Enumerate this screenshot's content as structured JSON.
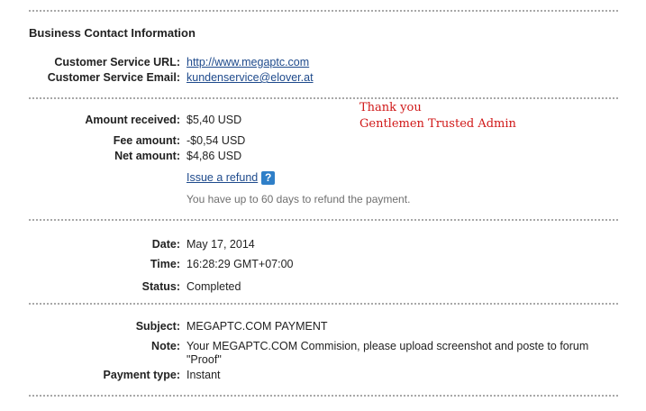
{
  "business": {
    "title": "Business Contact Information",
    "service_url_label": "Customer Service URL:",
    "service_url": "http://www.megaptc.com",
    "service_email_label": "Customer Service Email:",
    "service_email": "kundenservice@elover.at"
  },
  "amounts": {
    "received_label": "Amount received:",
    "received": "$5,40 USD",
    "fee_label": "Fee amount:",
    "fee": "-$0,54 USD",
    "net_label": "Net amount:",
    "net": "$4,86 USD",
    "refund_link": "Issue a refund",
    "help_icon_text": "?",
    "refund_hint": "You have up to 60 days to refund the payment."
  },
  "annotation": {
    "line1": "Thank you",
    "line2": "Gentlemen Trusted Admin"
  },
  "details": {
    "date_label": "Date:",
    "date": "May 17, 2014",
    "time_label": "Time:",
    "time": "16:28:29 GMT+07:00",
    "status_label": "Status:",
    "status": "Completed"
  },
  "payment": {
    "subject_label": "Subject:",
    "subject": "MEGAPTC.COM PAYMENT",
    "note_label": "Note:",
    "note": "Your MEGAPTC.COM Commision, please upload screenshot and poste to forum \"Proof\"",
    "type_label": "Payment type:",
    "type": "Instant"
  }
}
